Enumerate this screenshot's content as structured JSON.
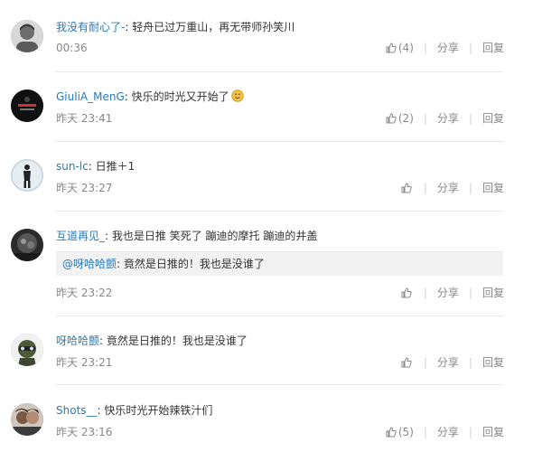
{
  "comments": [
    {
      "user": "我没有耐心了-",
      "text": "轻舟已过万重山，再无带师孙笑川",
      "time": "00:36",
      "like_count": "(4)",
      "share": "分享",
      "reply": "回复"
    },
    {
      "user": "GiuliA_MenG",
      "text": "快乐的时光又开始了",
      "emoji": "smile-emoji",
      "time": "昨天 23:41",
      "like_count": "(2)",
      "share": "分享",
      "reply": "回复"
    },
    {
      "user": "sun-lc",
      "text": "日推＋1",
      "time": "昨天 23:27",
      "like_count": "",
      "share": "分享",
      "reply": "回复"
    },
    {
      "user": "互道再见_",
      "text": "我也是日推 笑死了 蹦迪的摩托 蹦迪的井盖",
      "quote": {
        "user": "@呀哈哈颤",
        "text": "竟然是日推的！我也是没谁了"
      },
      "time": "昨天 23:22",
      "like_count": "",
      "share": "分享",
      "reply": "回复"
    },
    {
      "user": "呀哈哈颤",
      "text": "竟然是日推的！我也是没谁了",
      "time": "昨天 23:21",
      "like_count": "",
      "share": "分享",
      "reply": "回复"
    },
    {
      "user": "Shots__",
      "text": "快乐时光开始辣铁汁们",
      "time": "昨天 23:16",
      "like_count": "(5)",
      "share": "分享",
      "reply": "回复"
    }
  ],
  "colors": {
    "username": "#2a7ab8",
    "meta": "#888888",
    "divider": "#e9e9e9",
    "quote_bg": "#f2f2f2"
  },
  "icons": {
    "like": "thumbs-up-icon"
  }
}
